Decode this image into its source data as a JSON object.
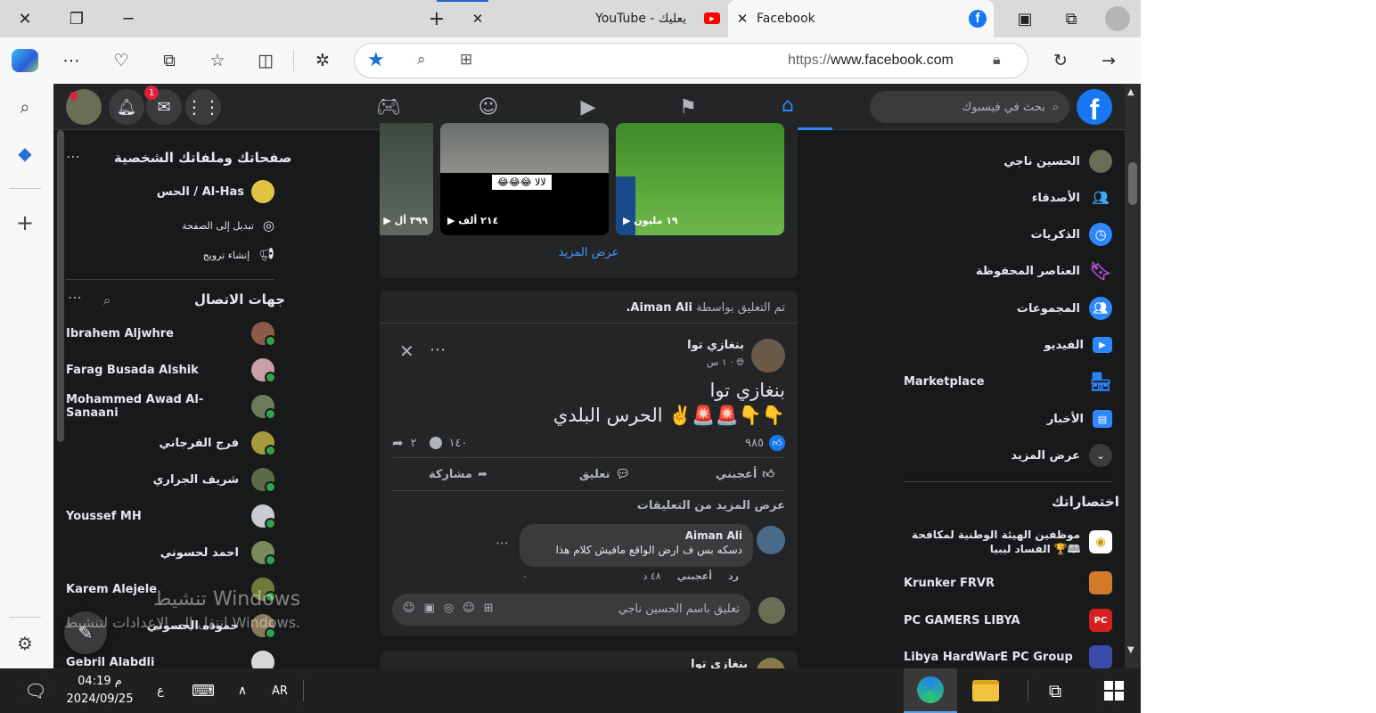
{
  "browser": {
    "tabs": [
      {
        "label": "YouTube - يعليك",
        "icon": "youtube-icon"
      },
      {
        "label": "Facebook",
        "icon": "facebook-icon",
        "active": true
      }
    ],
    "url_prefix": "https://",
    "url_host": "www.facebook.com"
  },
  "fb": {
    "search_placeholder": "بحث في فيسبوك",
    "notification_count": "1",
    "logo_letter": "f"
  },
  "left_panel": {
    "pages_title": "صفحاتك وملفاتك الشخصية",
    "page_name": "الحس / Al-Has",
    "switch_to_page": "تبديل إلى الصفحة",
    "create_promotion": "إنشاء ترويج",
    "contacts_title": "جهات الاتصال",
    "contacts": [
      "Ibrahem Aljwhre",
      "Farag Busada Alshik",
      "Mohammed Awad Al-Sanaani",
      "فرج الفرجاني",
      "شريف الجراري",
      "Youssef MH",
      "احمد لحسوني",
      "Karem Alejele",
      "حموده الحسوني",
      "Gebril Alabdli"
    ]
  },
  "right_panel": {
    "items": [
      {
        "label": "الحسين ناجي",
        "icon": "avatar"
      },
      {
        "label": "الأصدقاء",
        "icon": "friends-icon"
      },
      {
        "label": "الذكريات",
        "icon": "memories-icon"
      },
      {
        "label": "العناصر المحفوظة",
        "icon": "saved-icon"
      },
      {
        "label": "المجموعات",
        "icon": "groups-icon"
      },
      {
        "label": "الفيديو",
        "icon": "video-icon"
      },
      {
        "label": "Marketplace",
        "icon": "marketplace-icon"
      },
      {
        "label": "الأخبار",
        "icon": "news-icon"
      },
      {
        "label": "عرض المزيد",
        "icon": "chevron-down-icon"
      }
    ],
    "shortcuts_title": "اختصاراتك",
    "shortcuts": [
      "موظفين الهيئة الوطنية لمكافحة الفساد ليبيا 🏆🕮",
      "Krunker FRVR",
      "PC GAMERS LIBYA",
      "Libya HardWarE PC Group"
    ]
  },
  "feed": {
    "reels": [
      {
        "stat": "١٩ مليون"
      },
      {
        "stat": "٢١٤ ألف",
        "caption": "😂😂😂 لالا"
      },
      {
        "stat": "٣٩٩ أل"
      }
    ],
    "see_more": "عرض المزيد",
    "post": {
      "commented_by_prefix": "تم التعليق بواسطة",
      "commented_by_name": "Aiman Ali.",
      "author": "بنغازي توا",
      "time": "١ س ·",
      "line1": "بنغازي توا",
      "line2": "الحرس البلدي ✌️🚨🚨👇👇",
      "reactions_count": "٩٨٥",
      "comments_count": "١٤٠",
      "shares_count": "٢",
      "like": "أعجبني",
      "comment": "تعليق",
      "share": "مشاركة",
      "more_comments": "عرض المزيد من التعليقات",
      "comment_author": "Aiman Ali",
      "comment_text": "دسكه بس ف ارض الواقع مافيش كلام هذا",
      "comment_time": "٤٨ د",
      "comment_like": "أعجبني",
      "comment_reply": "رد",
      "comment_zero": "٠",
      "write_placeholder": "تعليق باسم الحسين ناجي"
    },
    "next_author": "بنغازي توا"
  },
  "watermark": {
    "title": "تنشيط Windows",
    "subtitle": "انتقل إلى الإعدادات لتنشيط Windows."
  },
  "taskbar": {
    "lang": "AR",
    "time": "04:19 م",
    "date": "2024/09/25",
    "input_char": "ع"
  },
  "colors": {
    "fb_blue": "#1877f2",
    "fb_bg": "#18191a",
    "fb_card": "#242526",
    "link_blue": "#2d88ff"
  }
}
